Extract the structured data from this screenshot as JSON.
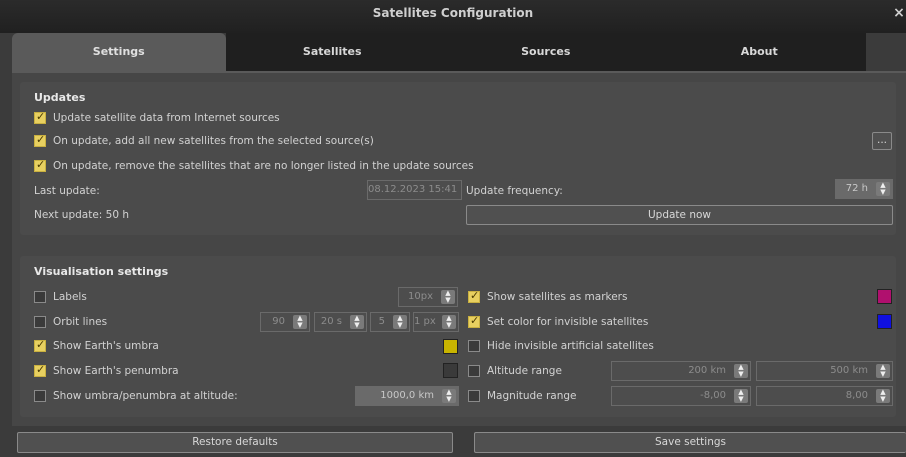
{
  "window": {
    "title": "Satellites Configuration",
    "close_glyph": "×"
  },
  "tabs": [
    "Settings",
    "Satellites",
    "Sources",
    "About"
  ],
  "updates": {
    "title": "Updates",
    "update_internet": "Update satellite data from Internet sources",
    "add_new": "On update, add all new satellites from the selected source(s)",
    "remove_old": "On update, remove the satellites that are no longer listed in the update sources",
    "ellipsis": "...",
    "last_update_label": "Last update:",
    "last_update_value": "08.12.2023 15:41",
    "frequency_label": "Update frequency:",
    "frequency_value": "72 h",
    "next_update": "Next update: 50 h",
    "update_now": "Update now"
  },
  "vis": {
    "title": "Visualisation settings",
    "labels": "Labels",
    "labels_size": "10px",
    "orbit_lines": "Orbit lines",
    "orbit_1": "90",
    "orbit_2": "20 s",
    "orbit_3": "5",
    "orbit_4": "1 px",
    "umbra": "Show Earth's umbra",
    "penumbra": "Show Earth's penumbra",
    "umbra_alt": "Show umbra/penumbra at altitude:",
    "umbra_alt_value": "1000,0 km",
    "markers": "Show satellites as markers",
    "invisible_color": "Set color for invisible satellites",
    "hide_invisible": "Hide invisible artificial satellites",
    "altitude_range": "Altitude range",
    "alt_min": "200 km",
    "alt_max": "500 km",
    "magnitude_range": "Magnitude range",
    "mag_min": "-8,00",
    "mag_max": "8,00"
  },
  "colors": {
    "umbra": "#c8b400",
    "penumbra": "#3a3a3a",
    "markers": "#b0106e",
    "invisible": "#1010e0"
  },
  "buttons": {
    "restore": "Restore defaults",
    "save": "Save settings"
  }
}
